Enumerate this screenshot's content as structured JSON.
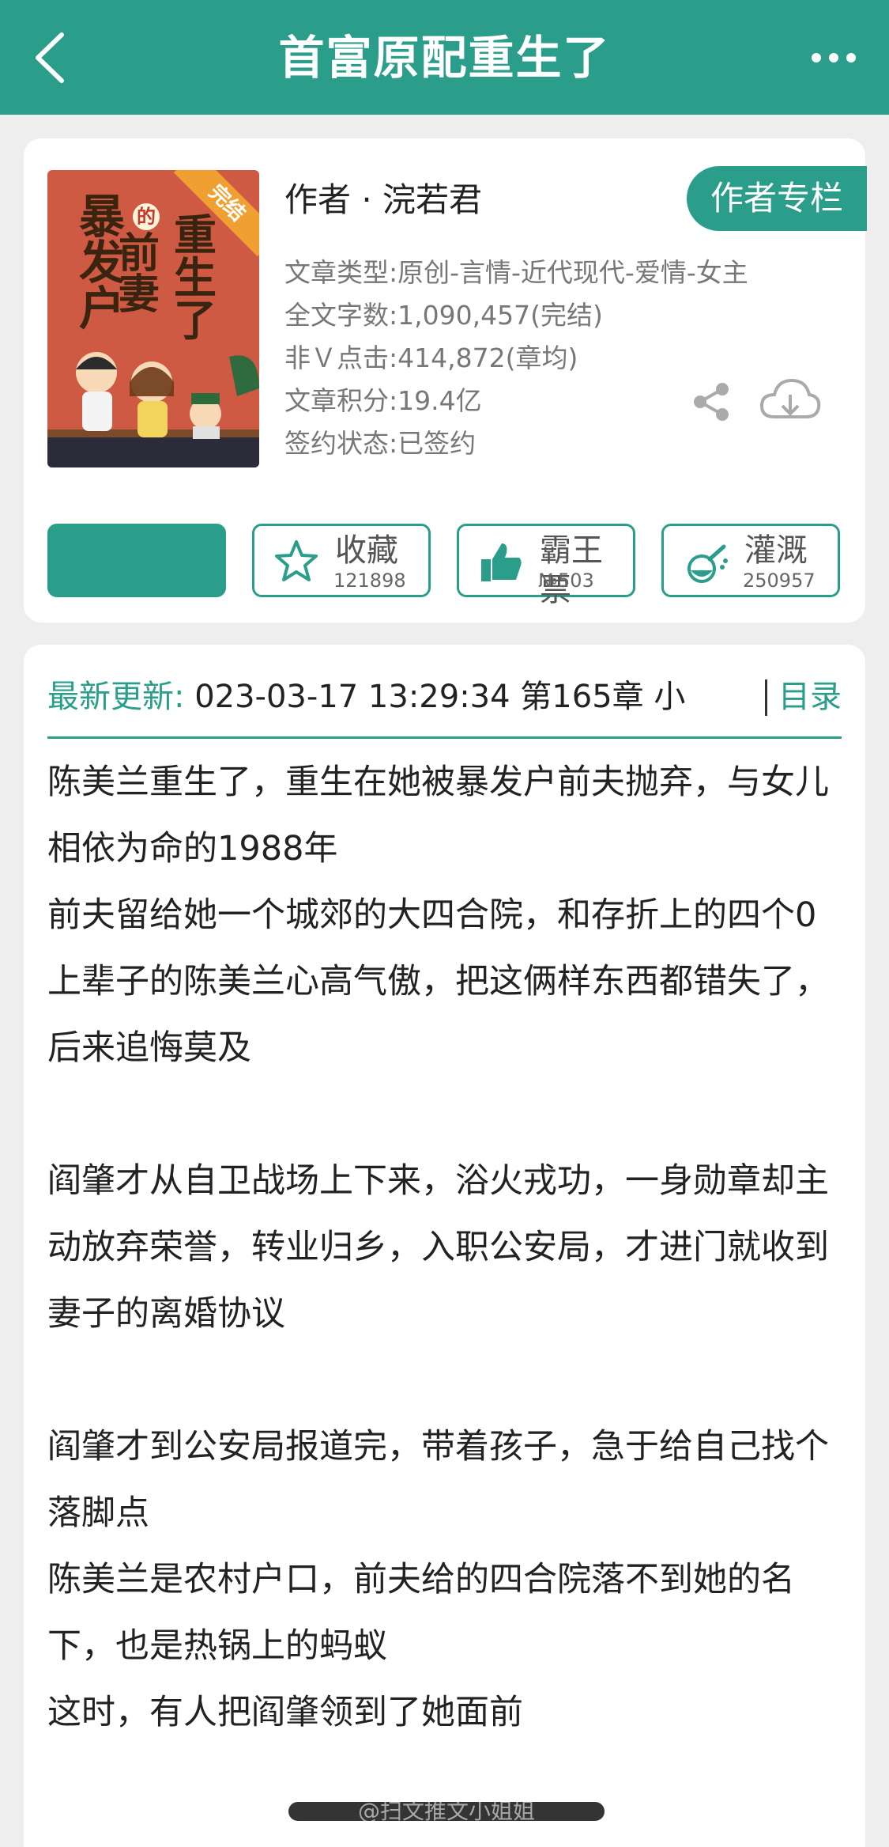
{
  "header": {
    "title": "首富原配重生了"
  },
  "book": {
    "cover_title_lines": [
      "暴发户",
      "前妻",
      "重生了"
    ],
    "cover_de": "的",
    "cover_badge": "完结",
    "author": "作者 · 浣若君",
    "author_column_button": "作者专栏",
    "meta": [
      "文章类型:原创-言情-近代现代-爱情-女主",
      "全文字数:1,090,457(完结)",
      "非Ｖ点击:414,872(章均)",
      "文章积分:19.4亿",
      "签约状态:已签约"
    ]
  },
  "actions": {
    "primary_label": "",
    "collect": {
      "label": "收藏",
      "count": "121898",
      "icon": "star-icon"
    },
    "bawang": {
      "label": "霸王票",
      "count": "№503",
      "icon": "thumbs-up-icon"
    },
    "irrigate": {
      "label": "灌溉",
      "count": "250957",
      "icon": "watering-can-icon"
    }
  },
  "update": {
    "label": "最新更新:",
    "value": " 023-03-17 13:29:34   第165章 小",
    "toc": "目录"
  },
  "summary": [
    "陈美兰重生了，重生在她被暴发户前夫抛弃，与女儿相依为命的1988年",
    "前夫留给她一个城郊的大四合院，和存折上的四个0",
    "上辈子的陈美兰心高气傲，把这俩样东西都错失了，后来追悔莫及",
    "",
    "阎肇才从自卫战场上下来，浴火戎功，一身勋章却主动放弃荣誉，转业归乡，入职公安局，才进门就收到妻子的离婚协议",
    "",
    "阎肇才到公安局报道完，带着孩子，急于给自己找个落脚点",
    "陈美兰是农村户口，前夫给的四合院落不到她的名下，也是热锅上的蚂蚁",
    "这时，有人把阎肇领到了她面前"
  ],
  "watermark": "@扫文推文小姐姐",
  "colors": {
    "accent": "#2a9d8b",
    "background": "#eeeeee",
    "card": "#ffffff"
  }
}
